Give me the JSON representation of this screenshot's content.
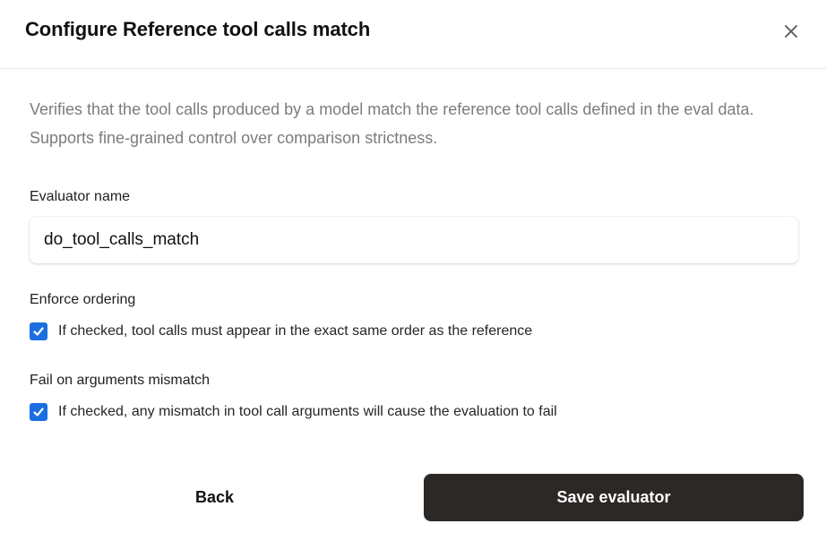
{
  "dialog": {
    "title": "Configure Reference tool calls match",
    "close_icon": "close-icon",
    "description": "Verifies that the tool calls produced by a model match the reference tool calls defined in the eval data. Supports fine-grained control over comparison strictness."
  },
  "evaluator_name": {
    "label": "Evaluator name",
    "value": "do_tool_calls_match",
    "placeholder": ""
  },
  "enforce_ordering": {
    "label": "Enforce ordering",
    "checkbox_label": "If checked, tool calls must appear in the exact same order as the reference",
    "checked": true
  },
  "fail_on_arguments_mismatch": {
    "label": "Fail on arguments mismatch",
    "checkbox_label": "If checked, any mismatch in tool call arguments will cause the evaluation to fail",
    "checked": true
  },
  "footer": {
    "back_label": "Back",
    "save_label": "Save evaluator"
  },
  "colors": {
    "checkbox_accent": "#1a6ee0",
    "primary_button": "#2c2826",
    "description_text": "#7c7c7c"
  }
}
